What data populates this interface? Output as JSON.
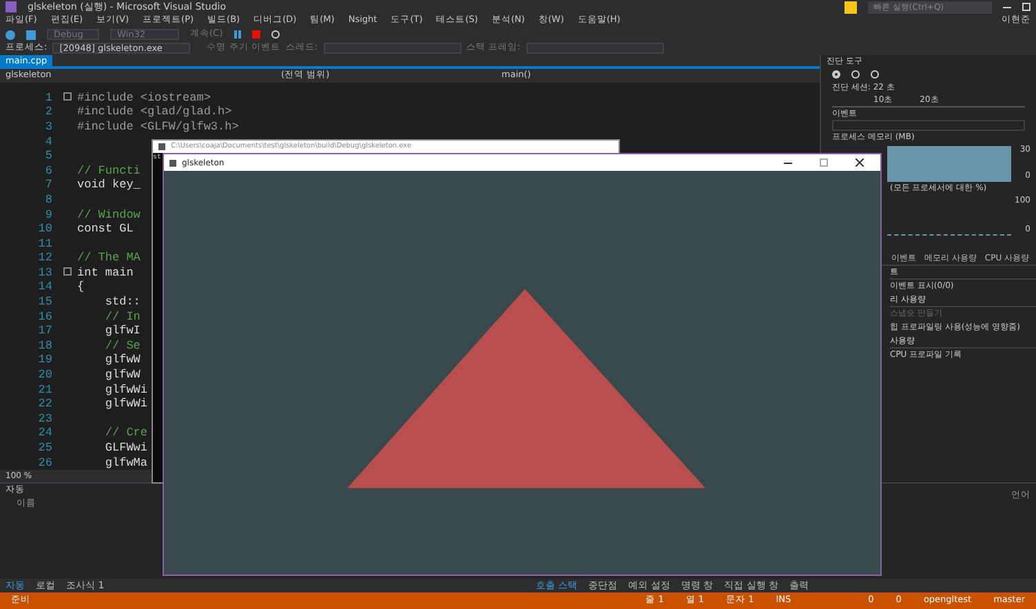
{
  "window": {
    "title": "glskeleton (실행) - Microsoft Visual Studio",
    "quick_launch": {
      "placeholder": "빠른 실행(Ctrl+Q)"
    },
    "user": "이현준"
  },
  "menu": [
    "파일(F)",
    "편집(E)",
    "보기(V)",
    "프로젝트(P)",
    "빌드(B)",
    "디버그(D)",
    "팀(M)",
    "Nsight",
    "도구(T)",
    "테스트(S)",
    "분석(N)",
    "창(W)",
    "도움말(H)"
  ],
  "toolbar": {
    "configuration": "Debug",
    "platform": "Win32",
    "continue": "계속(C)"
  },
  "debug_bar": {
    "process_label": "프로세스:",
    "process": "[20948] glskeleton.exe",
    "lifecycle": "수명 주기 이벤트",
    "thread_label": "스레드:",
    "stack_label": "스택 프레임:"
  },
  "tabs": [
    {
      "label": "main.cpp",
      "selected": true
    }
  ],
  "navigation": {
    "project": "glskeleton",
    "scope": "(전역 범위)",
    "function": "main()"
  },
  "code_lines": [
    {
      "number": "1",
      "kind": "preprocessor",
      "text": "#include <iostream>",
      "fold": true
    },
    {
      "number": "2",
      "kind": "preprocessor",
      "text": "#include <glad/glad.h>"
    },
    {
      "number": "3",
      "kind": "preprocessor",
      "text": "#include <GLFW/glfw3.h>"
    },
    {
      "number": "4"
    },
    {
      "number": "5"
    },
    {
      "number": "6",
      "kind": "comment",
      "text": "// Functi"
    },
    {
      "number": "7",
      "kind": "code",
      "text": "void key_"
    },
    {
      "number": "8"
    },
    {
      "number": "9",
      "kind": "comment",
      "text": "// Window"
    },
    {
      "number": "10",
      "kind": "code",
      "text": "const GL"
    },
    {
      "number": "11"
    },
    {
      "number": "12",
      "kind": "comment",
      "text": "// The MA"
    },
    {
      "number": "13",
      "kind": "code",
      "text": "int main",
      "fold": true
    },
    {
      "number": "14",
      "kind": "code",
      "text": "{"
    },
    {
      "number": "15",
      "kind": "code",
      "text": "    std::"
    },
    {
      "number": "16",
      "kind": "comment",
      "text": "    // In"
    },
    {
      "number": "17",
      "kind": "code",
      "text": "    glfwI"
    },
    {
      "number": "18",
      "kind": "comment",
      "text": "    // Se"
    },
    {
      "number": "19",
      "kind": "code",
      "text": "    glfwW"
    },
    {
      "number": "20",
      "kind": "code",
      "text": "    glfwW"
    },
    {
      "number": "21",
      "kind": "code",
      "text": "    glfwWi"
    },
    {
      "number": "22",
      "kind": "code",
      "text": "    glfwWi"
    },
    {
      "number": "23"
    },
    {
      "number": "24",
      "kind": "comment",
      "text": "    // Cre"
    },
    {
      "number": "25",
      "kind": "code",
      "text": "    GLFWwi"
    },
    {
      "number": "26",
      "kind": "code",
      "text": "    glfwMa"
    }
  ],
  "zoom": "100 %",
  "console_window": {
    "title": "C:\\Users\\coaja\\Documents\\test\\glskeleton\\build\\Debug\\glskeleton.exe",
    "text": "st"
  },
  "gl_window": {
    "title": "glskeleton"
  },
  "diagnostics": {
    "title": "진단 도구",
    "session": "진단 세션: 22 초",
    "timeline": [
      "10초",
      "20초"
    ],
    "events_header": "이벤트",
    "memory_header": "프로세스 메모리 (MB)",
    "memory_ticks": [
      "30",
      "0"
    ],
    "cpu_header": "(모든 프로세서에 대한 %)",
    "cpu_ticks": [
      "100",
      "0"
    ],
    "tabs": [
      {
        "label": "이벤트",
        "selected": false
      },
      {
        "label": "메모리 사용량",
        "selected": false
      },
      {
        "label": "CPU 사용량",
        "selected": false
      }
    ],
    "items": [
      {
        "kind": "header",
        "text": "트"
      },
      {
        "kind": "link",
        "text": "이벤트 표시(0/0)"
      },
      {
        "kind": "header",
        "text": "리 사용량"
      },
      {
        "kind": "disabled",
        "text": "스냅숏 만들기"
      },
      {
        "kind": "link",
        "text": "힙 프로파일링 사용(성능에 영향줌)"
      },
      {
        "kind": "header",
        "text": "사용량"
      },
      {
        "kind": "link",
        "text": "CPU 프로파일 기록"
      }
    ]
  },
  "autos": {
    "title": "자동",
    "column": "이름",
    "tabs": [
      {
        "label": "자동",
        "selected": true
      },
      {
        "label": "로컬",
        "selected": false
      },
      {
        "label": "조사식 1",
        "selected": false
      }
    ]
  },
  "callstack": {
    "column": "언어",
    "tabs": [
      {
        "label": "호출 스택",
        "selected": true
      },
      {
        "label": "중단점",
        "selected": false
      },
      {
        "label": "예외 설정",
        "selected": false
      },
      {
        "label": "명령 창",
        "selected": false
      },
      {
        "label": "직접 실행 창",
        "selected": false
      },
      {
        "label": "출력",
        "selected": false
      }
    ]
  },
  "status_bar": {
    "state": "준비",
    "line": "줄 1",
    "column": "열 1",
    "char": "문자 1",
    "mode": "INS",
    "up": "0",
    "edits": "0",
    "repo": "opengltest",
    "branch": "master"
  }
}
